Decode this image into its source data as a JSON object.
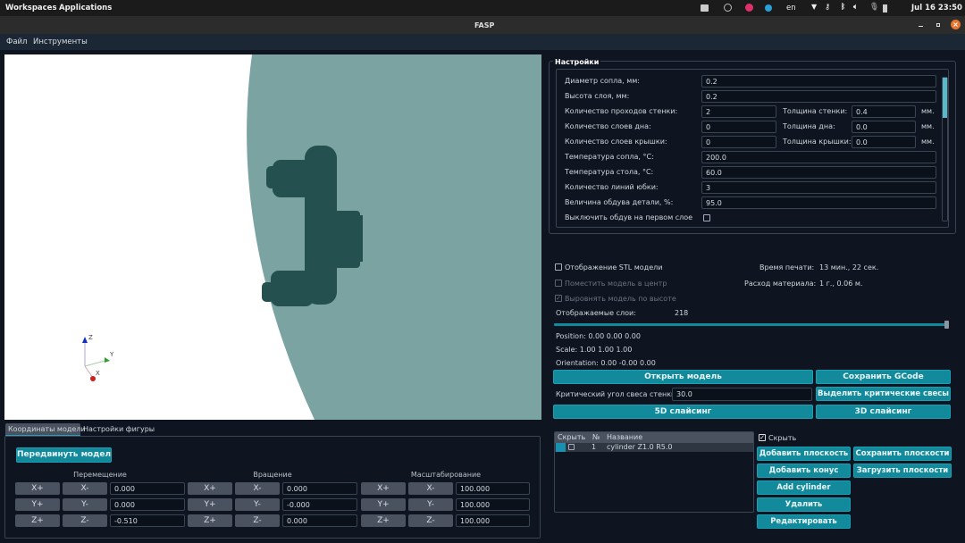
{
  "system_bar": {
    "workspaces": "Workspaces",
    "applications": "Applications",
    "language": "en",
    "clock": "Jul 16  23:50"
  },
  "window": {
    "title": "FASP"
  },
  "menu": [
    "Файл",
    "Инструменты"
  ],
  "viewport": {
    "axes": [
      "Z",
      "Y",
      "X"
    ],
    "colors": {
      "background": "#ffffff",
      "bed": "#7aa3a2",
      "model": "#24504f"
    }
  },
  "settings": {
    "title": "Настройки",
    "nozzle_diameter": {
      "label": "Диаметр сопла, мм:",
      "value": "0.2"
    },
    "layer_height": {
      "label": "Высота слоя, мм:",
      "value": "0.2"
    },
    "wall_passes": {
      "label": "Количество проходов стенки:",
      "value": "2",
      "label2": "Толщина стенки:",
      "value2": "0.4",
      "unit": "мм."
    },
    "bottom_layers": {
      "label": "Количество слоев дна:",
      "value": "0",
      "label2": "Толщина дна:",
      "value2": "0.0",
      "unit": "мм."
    },
    "top_layers": {
      "label": "Количество слоев крышки:",
      "value": "0",
      "label2": "Толщина крышки:",
      "value2": "0.0",
      "unit": "мм."
    },
    "nozzle_temp": {
      "label": "Температура сопла, °C:",
      "value": "200.0"
    },
    "bed_temp": {
      "label": "Температура стола, °C:",
      "value": "60.0"
    },
    "skirt_lines": {
      "label": "Количество линий юбки:",
      "value": "3"
    },
    "fan": {
      "label": "Величина обдува детали, %:",
      "value": "95.0"
    },
    "fan_first_layer": {
      "label": "Выключить обдув на первом слое",
      "checked": false
    }
  },
  "display": {
    "show_stl": {
      "label": "Отображение STL модели",
      "checked": false
    },
    "center_model": {
      "label": "Поместить модель в центр",
      "checked": false,
      "disabled": true
    },
    "align_height": {
      "label": "Выровнять модель по высоте",
      "checked": true,
      "disabled": true
    },
    "print_time_label": "Время печати:",
    "print_time": "13 мин., 22 сек.",
    "material_label": "Расход материала:",
    "material": "1 г., 0.06 м.",
    "layers_label": "Отображаемые слои:",
    "layers_value": "218",
    "layers_slider_fraction": 1.0,
    "position": "Position: 0.00 0.00 0.00",
    "scale": "Scale: 1.00 1.00 1.00",
    "orientation": "Orientation: 0.00 -0.00 0.00"
  },
  "actions": {
    "open_model": "Открыть модель",
    "save_gcode": "Сохранить GCode",
    "overhang_label": "Критический угол свеса стенки:",
    "overhang_value": "30.0",
    "highlight_overhangs": "Выделить критические свесы",
    "slice_5d": "5D слайсинг",
    "slice_3d": "3D слайсинг"
  },
  "tabs": [
    "Координаты модели",
    "Настройки фигуры"
  ],
  "coords": {
    "move_button": "Передвинуть модель",
    "groups": [
      {
        "title": "Перемещение",
        "values": [
          "0.000",
          "0.000",
          "-0.510"
        ]
      },
      {
        "title": "Вращение",
        "values": [
          "0.000",
          "-0.000",
          "0.000"
        ]
      },
      {
        "title": "Масштабирование",
        "values": [
          "100.000",
          "100.000",
          "100.000"
        ]
      }
    ],
    "axes": [
      [
        "X+",
        "X-"
      ],
      [
        "Y+",
        "Y-"
      ],
      [
        "Z+",
        "Z-"
      ]
    ]
  },
  "figures": {
    "columns": [
      "Скрыть",
      "№",
      "Название"
    ],
    "rows": [
      {
        "hide": false,
        "num": "1",
        "name": "cylinder Z1.0 R5.0"
      }
    ],
    "hide_label": "Скрыть",
    "hide_checked": true,
    "add_plane": "Добавить плоскость",
    "save_planes": "Сохранить плоскости",
    "add_cone": "Добавить конус",
    "load_planes": "Загрузить плоскости",
    "add_cylinder": "Add cylinder",
    "delete": "Удалить",
    "edit": "Редактировать"
  }
}
